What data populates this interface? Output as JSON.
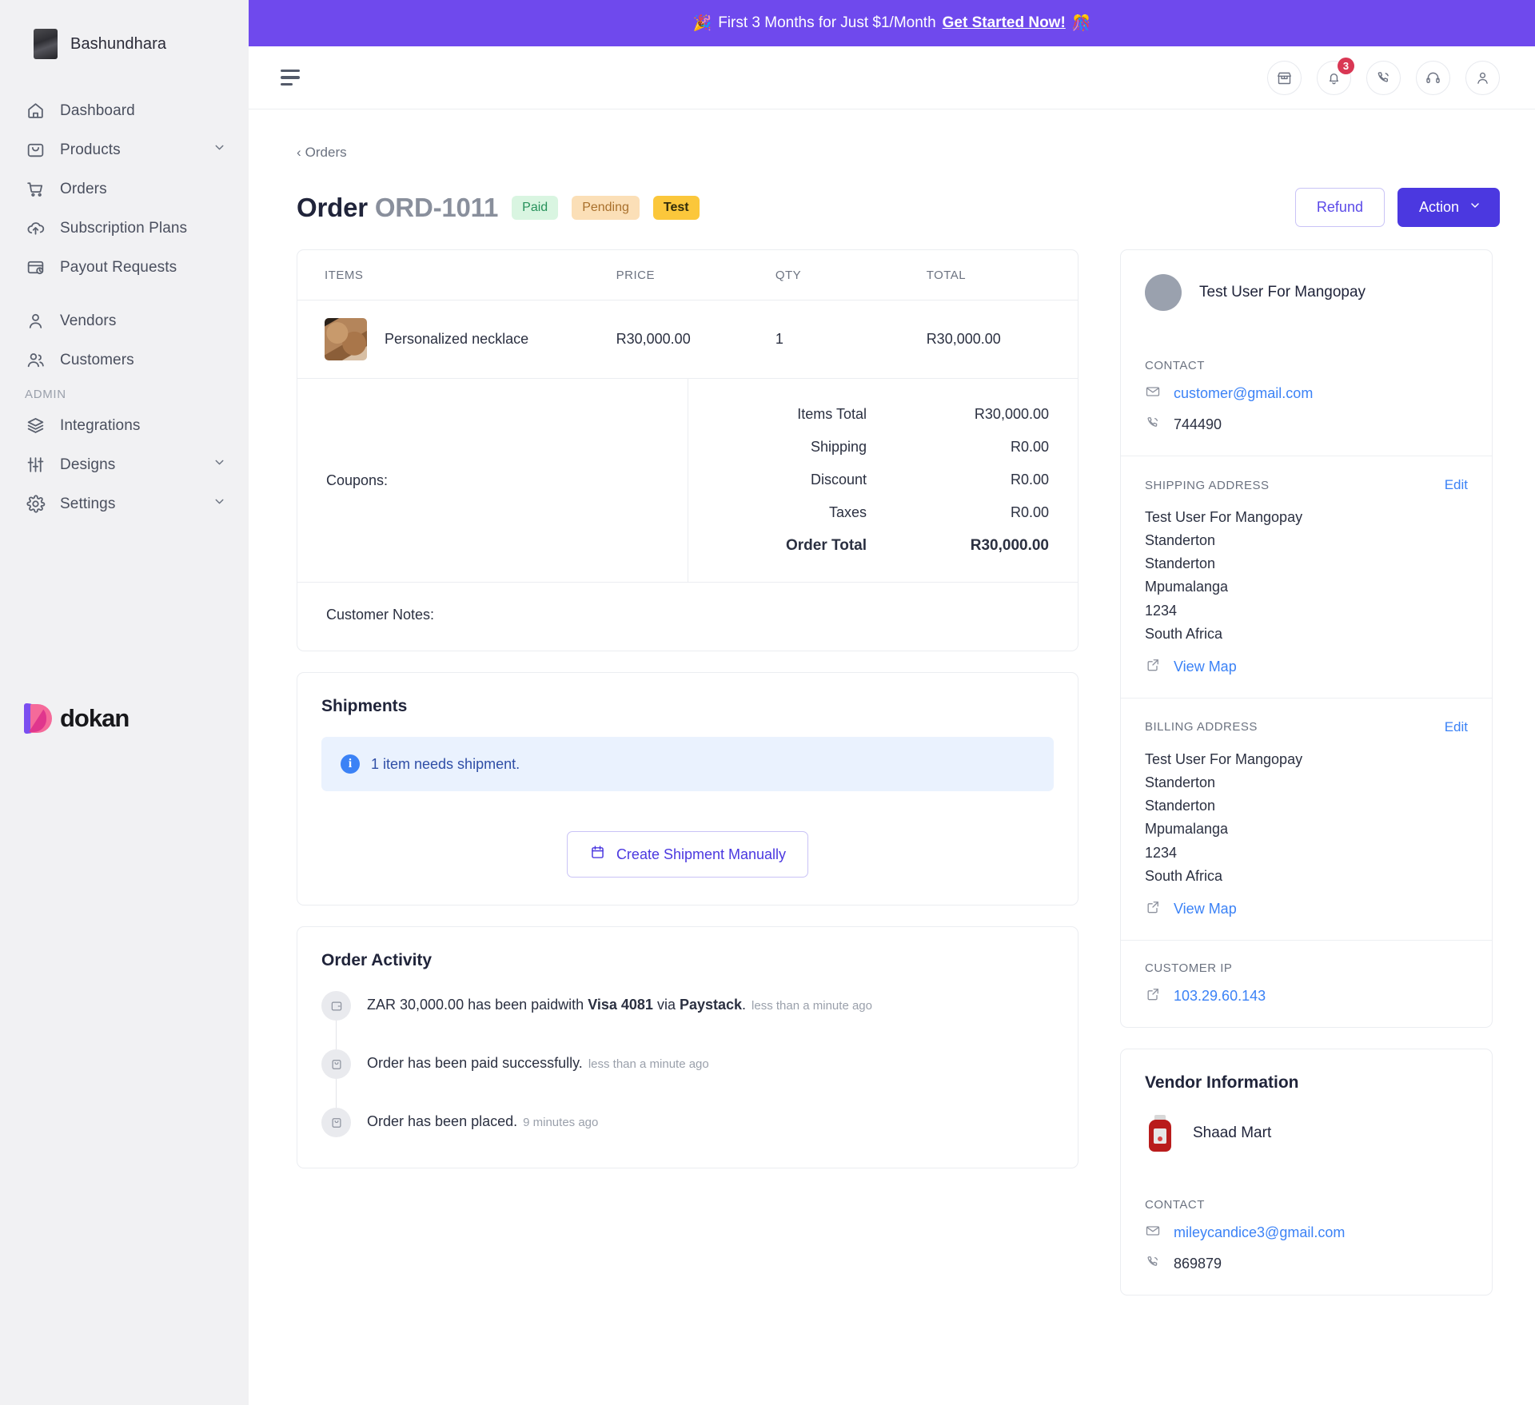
{
  "sidebar": {
    "brand": "Bashundhara",
    "items": [
      {
        "label": "Dashboard",
        "icon": "home-icon",
        "chevron": false
      },
      {
        "label": "Products",
        "icon": "bag-icon",
        "chevron": true
      },
      {
        "label": "Orders",
        "icon": "cart-icon",
        "chevron": false
      },
      {
        "label": "Subscription Plans",
        "icon": "cloud-upload-icon",
        "chevron": false
      },
      {
        "label": "Payout Requests",
        "icon": "payout-icon",
        "chevron": false
      }
    ],
    "items2": [
      {
        "label": "Vendors",
        "icon": "user-icon",
        "chevron": false
      },
      {
        "label": "Customers",
        "icon": "users-icon",
        "chevron": false
      }
    ],
    "section_label": "ADMIN",
    "admin_items": [
      {
        "label": "Integrations",
        "icon": "layers-icon",
        "chevron": false
      },
      {
        "label": "Designs",
        "icon": "sliders-icon",
        "chevron": true
      },
      {
        "label": "Settings",
        "icon": "gear-icon",
        "chevron": true
      }
    ],
    "footer_logo_text": "dokan"
  },
  "promo": {
    "emoji_left": "🎉",
    "text": "First 3 Months for Just $1/Month",
    "link": "Get Started Now!",
    "emoji_right": "🎊",
    "bg_color": "#6f49ed"
  },
  "topbar": {
    "icons": [
      {
        "name": "store-icon",
        "badge": null
      },
      {
        "name": "bell-icon",
        "badge": "3"
      },
      {
        "name": "phone-icon",
        "badge": null
      },
      {
        "name": "headset-icon",
        "badge": null
      },
      {
        "name": "user-icon",
        "badge": null
      }
    ]
  },
  "page": {
    "breadcrumb": "Orders",
    "title_prefix": "Order",
    "order_id": "ORD-1011",
    "status_chips": [
      {
        "label": "Paid",
        "type": "paid"
      },
      {
        "label": "Pending",
        "type": "pending"
      },
      {
        "label": "Test",
        "type": "test"
      }
    ],
    "refund_label": "Refund",
    "action_label": "Action"
  },
  "items_table": {
    "headers": [
      "ITEMS",
      "PRICE",
      "QTY",
      "TOTAL"
    ],
    "rows": [
      {
        "name": "Personalized necklace",
        "price": "R30,000.00",
        "qty": "1",
        "total": "R30,000.00"
      }
    ]
  },
  "totals": {
    "coupons_label": "Coupons:",
    "lines": [
      {
        "label": "Items Total",
        "value": "R30,000.00"
      },
      {
        "label": "Shipping",
        "value": "R0.00"
      },
      {
        "label": "Discount",
        "value": "R0.00"
      },
      {
        "label": "Taxes",
        "value": "R0.00"
      }
    ],
    "grand_label": "Order Total",
    "grand_value": "R30,000.00",
    "customer_notes_label": "Customer Notes:"
  },
  "shipments": {
    "title": "Shipments",
    "info": "1 item needs shipment.",
    "button": "Create Shipment Manually"
  },
  "activity": {
    "title": "Order Activity",
    "entries": [
      {
        "pre": "ZAR 30,000.00 has been paidwith ",
        "bold1": "Visa 4081",
        "mid": " via ",
        "bold2": "Paystack",
        "post": ".",
        "time": "less than a minute ago"
      },
      {
        "pre": "Order has been paid successfully.",
        "bold1": "",
        "mid": "",
        "bold2": "",
        "post": "",
        "time": "less than a minute ago"
      },
      {
        "pre": "Order has been placed.",
        "bold1": "",
        "mid": "",
        "bold2": "",
        "post": "",
        "time": "9 minutes ago"
      }
    ]
  },
  "customer": {
    "name": "Test User For Mangopay",
    "contact_label": "CONTACT",
    "email": "customer@gmail.com",
    "phone": "744490",
    "shipping": {
      "label": "SHIPPING ADDRESS",
      "edit": "Edit",
      "lines": [
        "Test User For Mangopay",
        "Standerton",
        "Standerton",
        "Mpumalanga",
        "1234",
        "South Africa"
      ],
      "view_map": "View Map"
    },
    "billing": {
      "label": "BILLING ADDRESS",
      "edit": "Edit",
      "lines": [
        "Test User For Mangopay",
        "Standerton",
        "Standerton",
        "Mpumalanga",
        "1234",
        "South Africa"
      ],
      "view_map": "View Map"
    },
    "ip_label": "CUSTOMER IP",
    "ip": "103.29.60.143"
  },
  "vendor": {
    "title": "Vendor Information",
    "name": "Shaad Mart",
    "contact_label": "CONTACT",
    "email": "mileycandice3@gmail.com",
    "phone": "869879"
  }
}
